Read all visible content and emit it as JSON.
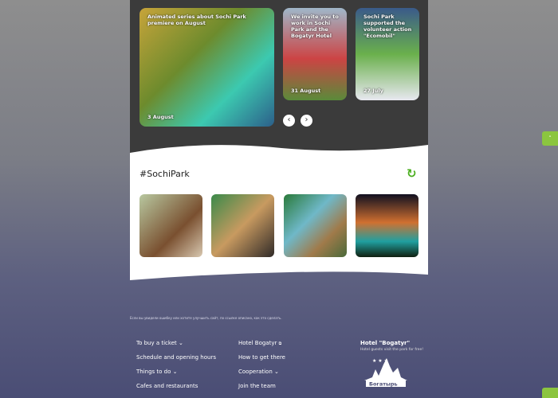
{
  "news": [
    {
      "title": "Animated series about Sochi Park premiere on August",
      "date": "3 August"
    },
    {
      "title": "We invite you to work in Sochi Park and the Bogatyr Hotel",
      "date": "31 August"
    },
    {
      "title": "Sochi Park supported the volunteer action \"Ecomobil\"",
      "date": "27 July"
    }
  ],
  "nav": {
    "prev": "‹",
    "next": "›"
  },
  "hashtag": {
    "title": "#SochiPark",
    "refresh": "↻"
  },
  "footer": {
    "note": "Если вы увидели ошибку или хотите улучшить сайт, по ссылке описано, как это сделать.",
    "col1": [
      "To buy a ticket",
      "Schedule and opening hours",
      "Things to do",
      "Cafes and restaurants"
    ],
    "col2": [
      "Hotel Bogatyr",
      "How to get there",
      "Cooperation",
      "Join the team"
    ],
    "hotel_title": "Hotel \"Bogatyr\"",
    "hotel_sub": "Hotel guests visit the park for free!",
    "logo_text": "Богатырь"
  },
  "colors": {
    "accent": "#8bc53f",
    "dark": "#3b3b3b"
  }
}
